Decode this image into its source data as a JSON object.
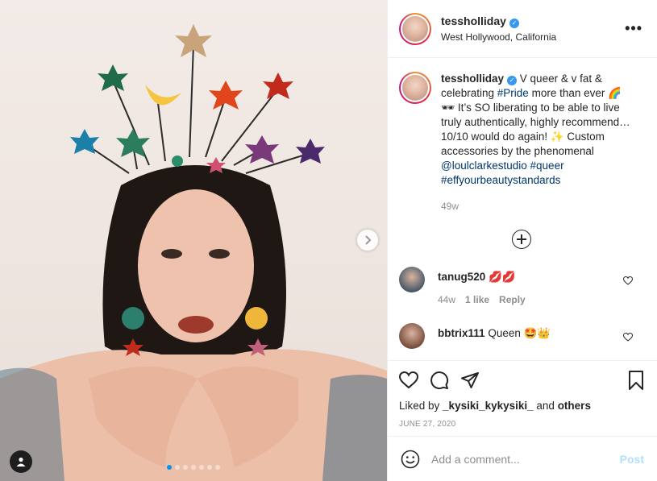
{
  "header": {
    "username": "tessholliday",
    "location": "West Hollywood, California",
    "more_icon": "•••"
  },
  "caption": {
    "username": "tessholliday",
    "text_part1": "V queer & v fat & celebrating ",
    "hashtag_pride": "#Pride",
    "text_part2": " more than ever 🌈🕶 It’s SO liberating to be able to live truly authentically, highly recommend… 10/10 would do again! ✨ Custom accessories by the phenomenal ",
    "mention": "@loulclarkestudio",
    "hashtag_queer": "#queer",
    "hashtag_effy": "#effyourbeautystandards",
    "age": "49w"
  },
  "comments": [
    {
      "username": "tanug520",
      "text": "💋💋",
      "age": "44w",
      "likes": "1 like",
      "reply": "Reply",
      "avatar_color": "#4a5a68"
    },
    {
      "username": "bbtrix111",
      "text": "Queen 🤩👑",
      "avatar_color": "#7a4e3c"
    }
  ],
  "actions": {
    "liked_by_prefix": "Liked by ",
    "liked_by_user": "_kysiki_kykysiki_",
    "liked_by_and": " and ",
    "liked_by_others": "others",
    "date": "JUNE 27, 2020"
  },
  "add_comment": {
    "placeholder": "Add a comment...",
    "post_label": "Post"
  },
  "carousel": {
    "slide_count": 7,
    "active_index": 0
  },
  "colors": {
    "link": "#00376b",
    "verified": "#3897f0",
    "post_disabled": "#b2dffc",
    "active_dot": "#0095f6"
  }
}
